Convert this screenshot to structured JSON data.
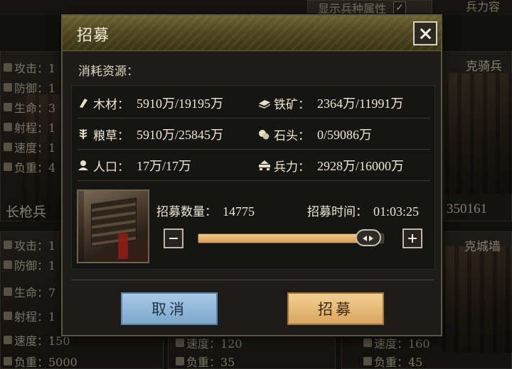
{
  "background": {
    "show_attr_label": "显示兵种属性",
    "show_attr_checked": "✓",
    "top_right_label": "兵力容",
    "cards": [
      {
        "name": "",
        "stats": [
          "攻击：1",
          "防御：1",
          "生命：3",
          "射程：1",
          "速度：1",
          "负重：4"
        ]
      },
      {
        "name": "克骑兵",
        "stats": []
      },
      {
        "name": "长枪兵",
        "stats": []
      },
      {
        "name": "350161",
        "stats": []
      },
      {
        "name": "克城墙",
        "stats": [
          "攻击：1",
          "防御：1",
          "生命：7",
          "射程：1",
          "速度：150",
          "负重：5000"
        ]
      },
      {
        "name": "",
        "stats": [
          "速度：120",
          "负重：35"
        ]
      },
      {
        "name": "",
        "stats": [
          "速度：160",
          "负重：45"
        ]
      }
    ]
  },
  "dialog": {
    "title": "招募",
    "cost_label": "消耗资源：",
    "resources": [
      {
        "label": "木材：",
        "value": "5910万/19195万",
        "icon": "wood-icon"
      },
      {
        "label": "铁矿：",
        "value": "2364万/11991万",
        "icon": "iron-icon"
      },
      {
        "label": "粮草：",
        "value": "5910万/25845万",
        "icon": "grain-icon"
      },
      {
        "label": "石头：",
        "value": "0/59086万",
        "icon": "stone-icon"
      },
      {
        "label": "人口：",
        "value": "17万/17万",
        "icon": "population-icon"
      },
      {
        "label": "兵力：",
        "value": "2928万/16000万",
        "icon": "troops-icon"
      }
    ],
    "quantity_label": "招募数量：",
    "quantity_value": "14775",
    "time_label": "招募时间：",
    "time_value": "01:03:25",
    "slider_level": 0.92,
    "cancel_label": "取消",
    "confirm_label": "招募"
  },
  "colors": {
    "header_gold": "#5a5226",
    "slider_fill": "#e3ae68",
    "cancel_blue": "#8db4d8",
    "confirm_gold": "#e6b877"
  }
}
